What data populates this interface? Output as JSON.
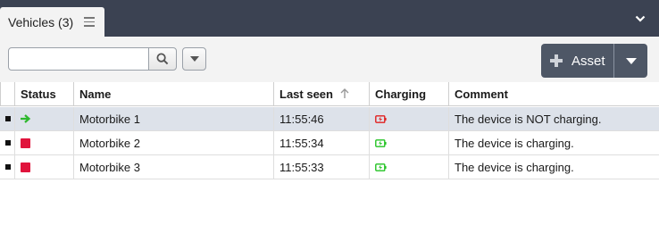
{
  "tab": {
    "label": "Vehicles (3)"
  },
  "search": {
    "value": "",
    "placeholder": ""
  },
  "asset_button": {
    "label": "Asset"
  },
  "columns": [
    "Status",
    "Name",
    "Last seen",
    "Charging",
    "Comment"
  ],
  "rows": [
    {
      "status": "arrow-right-green",
      "name": "Motorbike 1",
      "last_seen": "11:55:46",
      "charging": "battery-red-icon",
      "comment": "The device is NOT charging.",
      "selected": true
    },
    {
      "status": "square-red",
      "name": "Motorbike 2",
      "last_seen": "11:55:34",
      "charging": "battery-green-icon",
      "comment": "The device is charging.",
      "selected": false
    },
    {
      "status": "square-red",
      "name": "Motorbike 3",
      "last_seen": "11:55:33",
      "charging": "battery-green-icon",
      "comment": "The device is charging.",
      "selected": false
    }
  ],
  "colors": {
    "tabbar": "#3b4252",
    "selected_row": "#dde2ea",
    "status_red": "#e0143c",
    "arrow_green": "#2eb82e",
    "battery_red": "#e02020",
    "battery_green": "#22c322",
    "button_dark": "#4e5766"
  }
}
